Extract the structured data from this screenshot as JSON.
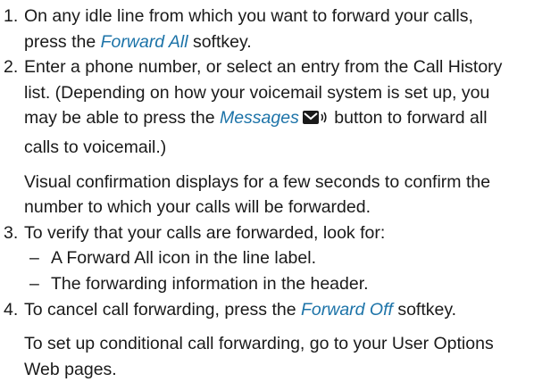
{
  "colors": {
    "text": "#1a1a1a",
    "softkey": "#1c73a8"
  },
  "steps": [
    {
      "number": "1.",
      "line1": "On any idle line from which you want to forward your calls,",
      "line2_pre": "press the ",
      "softkey": "Forward All",
      "line2_post": " softkey."
    },
    {
      "number": "2.",
      "line1": "Enter a phone number, or select an entry from the Call History",
      "line2": "list. (Depending on how your voicemail system is set up, you",
      "line3_pre": "may be able to press the ",
      "softkey": "Messages",
      "icon": "envelope-voicemail-icon",
      "line3_post": " button to forward all",
      "line4": "calls to voicemail.)",
      "note_line1": "Visual confirmation displays for a few seconds to confirm the",
      "note_line2": "number to which your calls will be forwarded."
    },
    {
      "number": "3.",
      "line1": "To verify that your calls are forwarded, look for:",
      "bullets": [
        "A Forward All icon in the line label.",
        "The forwarding information in the header."
      ],
      "dash": "–"
    },
    {
      "number": "4.",
      "line1_pre": "To cancel call forwarding, press the ",
      "softkey": "Forward Off",
      "line1_post": " softkey.",
      "note_line1": "To set up conditional call forwarding, go to your User Options",
      "note_line2": "Web pages."
    }
  ]
}
